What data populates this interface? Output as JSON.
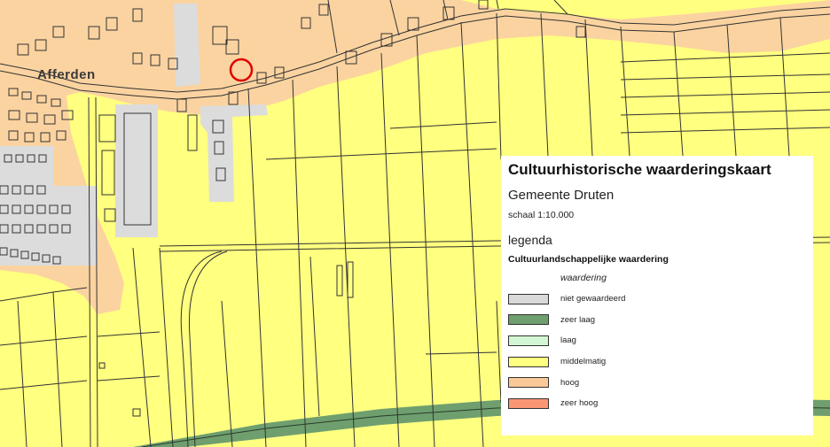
{
  "map": {
    "place_name": "Afferden",
    "colors": {
      "background": "#ffff80",
      "high": "#fbd3a0",
      "unvalued": "#dcdcdc",
      "very_low": "#6f9f6f",
      "lines": "#333333",
      "marker": "#e00000"
    }
  },
  "legend": {
    "title": "Cultuurhistorische waarderingskaart",
    "municipality": "Gemeente Druten",
    "scale": "schaal 1:10.000",
    "heading": "legenda",
    "subheading": "Cultuurlandschappelijke waardering",
    "valuation_label": "waardering",
    "items": [
      {
        "label": "niet gewaardeerd",
        "color": "#d9d9d9"
      },
      {
        "label": "zeer laag",
        "color": "#6e9f6e"
      },
      {
        "label": "laag",
        "color": "#d2f7d2"
      },
      {
        "label": "middelmatig",
        "color": "#ffff80"
      },
      {
        "label": "hoog",
        "color": "#fbc898"
      },
      {
        "label": "zeer hoog",
        "color": "#fb9675"
      }
    ]
  }
}
